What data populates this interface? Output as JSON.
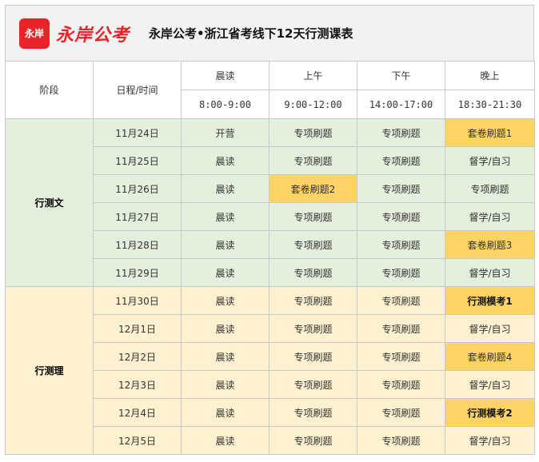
{
  "logo": {
    "badge": "永岸",
    "text": "永岸公考"
  },
  "title": "永岸公考•浙江省考线下12天行测课表",
  "header": {
    "stage": "阶段",
    "date": "日程/时间",
    "periods": [
      {
        "label": "晨读",
        "time": "8:00-9:00"
      },
      {
        "label": "上午",
        "time": "9:00-12:00"
      },
      {
        "label": "下午",
        "time": "14:00-17:00"
      },
      {
        "label": "晚上",
        "time": "18:30-21:30"
      }
    ]
  },
  "stages": [
    {
      "name": "行测文",
      "color": "#e4efdc"
    },
    {
      "name": "行测理",
      "color": "#fef1d0"
    }
  ],
  "highlight_color": "#fdd366",
  "rows": [
    {
      "date": "11月24日",
      "c": [
        "开营",
        "专项刷题",
        "专项刷题",
        "套卷刷题1"
      ]
    },
    {
      "date": "11月25日",
      "c": [
        "晨读",
        "专项刷题",
        "专项刷题",
        "督学/自习"
      ]
    },
    {
      "date": "11月26日",
      "c": [
        "晨读",
        "套卷刷题2",
        "专项刷题",
        "专项刷题"
      ]
    },
    {
      "date": "11月27日",
      "c": [
        "晨读",
        "专项刷题",
        "专项刷题",
        "督学/自习"
      ]
    },
    {
      "date": "11月28日",
      "c": [
        "晨读",
        "专项刷题",
        "专项刷题",
        "套卷刷题3"
      ]
    },
    {
      "date": "11月29日",
      "c": [
        "晨读",
        "专项刷题",
        "专项刷题",
        "督学/自习"
      ]
    },
    {
      "date": "11月30日",
      "c": [
        "晨读",
        "专项刷题",
        "专项刷题",
        "行测模考1"
      ]
    },
    {
      "date": "12月1日",
      "c": [
        "晨读",
        "专项刷题",
        "专项刷题",
        "督学/自习"
      ]
    },
    {
      "date": "12月2日",
      "c": [
        "晨读",
        "专项刷题",
        "专项刷题",
        "套卷刷题4"
      ]
    },
    {
      "date": "12月3日",
      "c": [
        "晨读",
        "专项刷题",
        "专项刷题",
        "督学/自习"
      ]
    },
    {
      "date": "12月4日",
      "c": [
        "晨读",
        "专项刷题",
        "专项刷题",
        "行测模考2"
      ]
    },
    {
      "date": "12月5日",
      "c": [
        "晨读",
        "专项刷题",
        "专项刷题",
        "督学/自习"
      ]
    }
  ]
}
